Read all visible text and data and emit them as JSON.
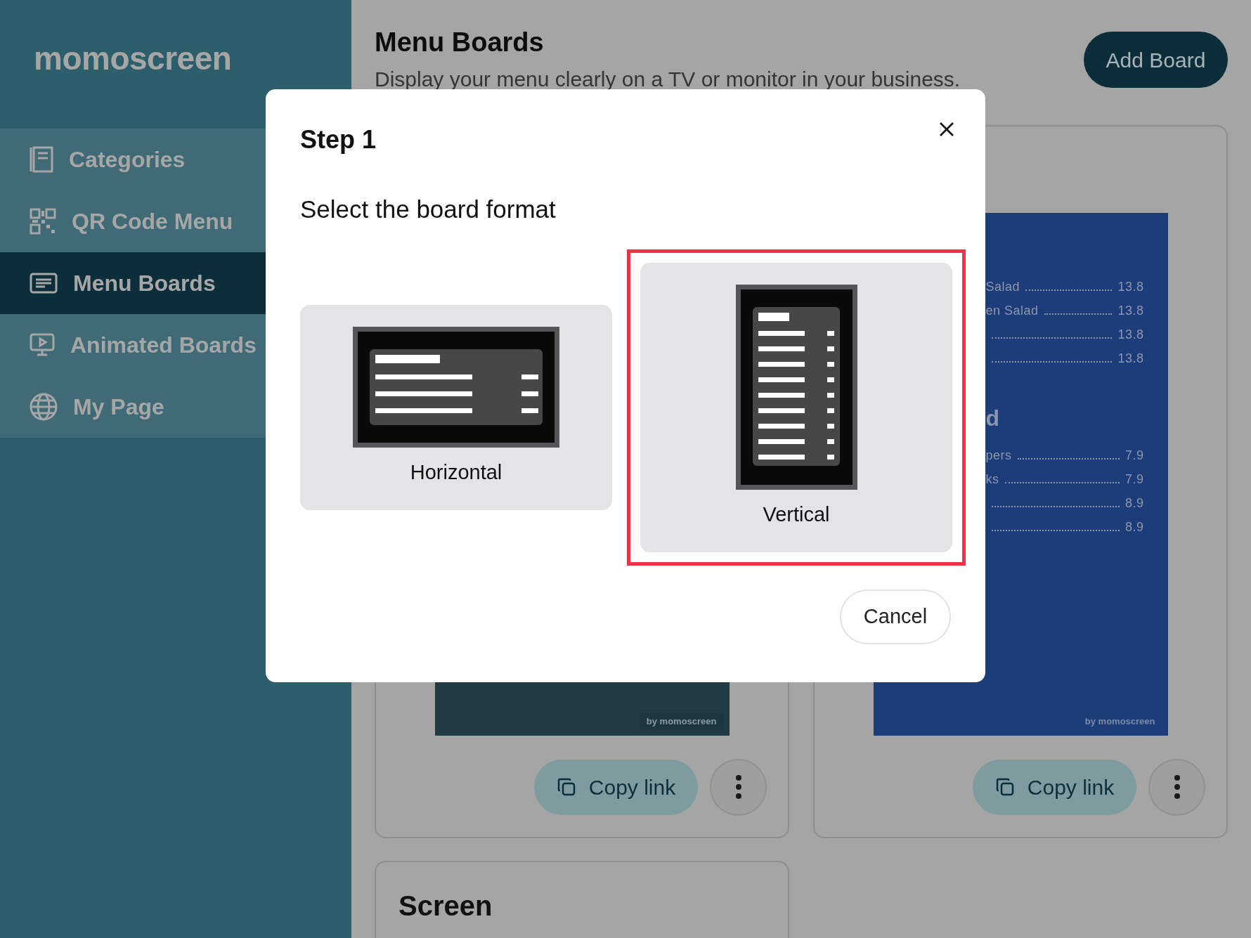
{
  "sidebar": {
    "logo": "momoscreen",
    "items": [
      {
        "label": "Categories",
        "selected": false
      },
      {
        "label": "QR Code Menu",
        "selected": false
      },
      {
        "label": "Menu Boards",
        "selected": true
      },
      {
        "label": "Animated Boards",
        "selected": false
      },
      {
        "label": "My Page",
        "selected": false
      }
    ]
  },
  "header": {
    "title": "Menu Boards",
    "subtitle": "Display your menu clearly on a TV or monitor in your business.",
    "add_button": "Add Board"
  },
  "boards": [
    {
      "kind": "photo",
      "watermark": "by momoscreen",
      "copy_button": "Copy link"
    },
    {
      "kind": "menu",
      "watermark": "by momoscreen",
      "copy_button": "Copy link",
      "rows": [
        {
          "kind": "item",
          "name": "Salad",
          "price": "13.8"
        },
        {
          "kind": "item",
          "name": "en Salad",
          "price": "13.8"
        },
        {
          "kind": "item",
          "price": "13.8"
        },
        {
          "kind": "item",
          "price": "13.8"
        },
        {
          "kind": "heading",
          "name": "d"
        },
        {
          "kind": "item",
          "name": "pers",
          "price": "7.9"
        },
        {
          "kind": "item",
          "name": "ks",
          "price": "7.9"
        },
        {
          "kind": "item",
          "price": "8.9"
        },
        {
          "kind": "item",
          "price": "8.9"
        }
      ]
    }
  ],
  "next_card": {
    "title": "Screen"
  },
  "modal": {
    "title": "Step 1",
    "prompt": "Select the board format",
    "options": [
      {
        "kind": "horizontal",
        "label": "Horizontal",
        "selected": false
      },
      {
        "kind": "vertical",
        "label": "Vertical",
        "selected": true
      }
    ],
    "cancel": "Cancel"
  }
}
